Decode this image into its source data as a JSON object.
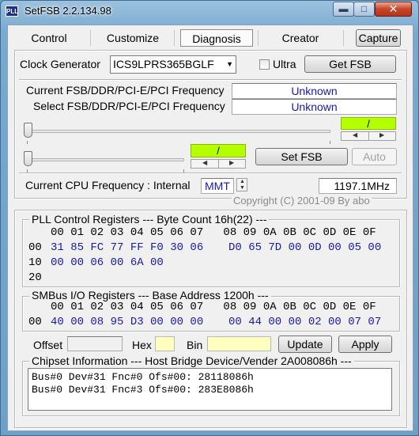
{
  "window": {
    "title": "SetFSB 2.2.134.98",
    "icon_text": "PLL"
  },
  "tabs": [
    {
      "label": "Control"
    },
    {
      "label": "Customize"
    },
    {
      "label": "Diagnosis"
    },
    {
      "label": "Creator"
    }
  ],
  "capture_label": "Capture",
  "clock": {
    "label": "Clock Generator",
    "selected": "ICS9LPRS365BGLF",
    "ultra_label": "Ultra",
    "get_fsb_label": "Get FSB"
  },
  "freq": {
    "current_label": "Current FSB/DDR/PCI-E/PCI Frequency",
    "current_value": "Unknown",
    "select_label": "Select FSB/DDR/PCI-E/PCI Frequency",
    "select_value": "Unknown",
    "slider1_value": "/",
    "slider2_value": "/",
    "set_fsb_label": "Set FSB",
    "auto_label": "Auto"
  },
  "cpu": {
    "label": "Current CPU Frequency : Internal",
    "mode": "MMT",
    "value": "1197.1MHz",
    "copyright": "Copyright (C) 2001-09 By abo"
  },
  "pll": {
    "title": "PLL Control Registers  --- Byte Count 16h(22) ---",
    "header": "00 01 02 03 04 05 06 07   08 09 0A 0B 0C 0D 0E 0F",
    "rows": [
      {
        "addr": "00",
        "low": "31 85 FC 77 FF F0 30 06",
        "high": "D0 65 7D 00 0D 00 05 00"
      },
      {
        "addr": "10",
        "low": "00 00 06 00 6A 00",
        "high": ""
      },
      {
        "addr": "20",
        "low": "",
        "high": ""
      }
    ]
  },
  "smbus": {
    "title": "SMBus I/O Registers  --- Base Address 1200h ---",
    "header": "00 01 02 03 04 05 06 07   08 09 0A 0B 0C 0D 0E 0F",
    "rows": [
      {
        "addr": "00",
        "low": "40 00 08 95 D3 00 00 00",
        "high": "00 44 00 00 02 00 07 07"
      }
    ],
    "offset_label": "Offset",
    "hex_label": "Hex",
    "bin_label": "Bin",
    "update_label": "Update",
    "apply_label": "Apply"
  },
  "chipset": {
    "title": "Chipset Information  --- Host Bridge Device/Vender 2A008086h ---",
    "lines": [
      "Bus#0 Dev#31 Fnc#0 Ofs#00: 28118086h",
      "Bus#0 Dev#31 Fnc#3 Ofs#00: 283E8086h"
    ]
  },
  "colors": {
    "accent_green": "#b4ff00",
    "value_blue": "#1a1aa6",
    "hex_yellow": "#ffffc0"
  }
}
